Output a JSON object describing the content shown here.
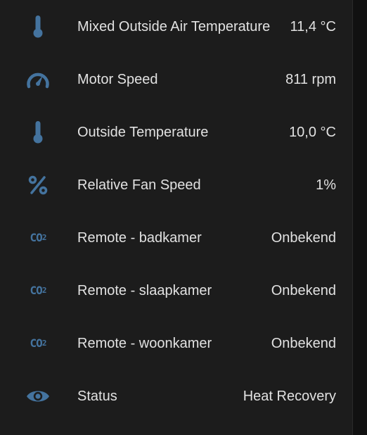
{
  "colors": {
    "background": "#1c1c1c",
    "text": "#e1e1e1",
    "icon": "#44739e"
  },
  "entities": [
    {
      "icon": "thermometer-icon",
      "label": "Mixed Outside Air Temperature",
      "value": "11,4 °C"
    },
    {
      "icon": "gauge-icon",
      "label": "Motor Speed",
      "value": "811 rpm"
    },
    {
      "icon": "thermometer-icon",
      "label": "Outside Temperature",
      "value": "10,0 °C"
    },
    {
      "icon": "percent-icon",
      "label": "Relative Fan Speed",
      "value": "1%"
    },
    {
      "icon": "co2-icon",
      "label": "Remote - badkamer",
      "value": "Onbekend"
    },
    {
      "icon": "co2-icon",
      "label": "Remote - slaapkamer",
      "value": "Onbekend"
    },
    {
      "icon": "co2-icon",
      "label": "Remote - woonkamer",
      "value": "Onbekend"
    },
    {
      "icon": "eye-icon",
      "label": "Status",
      "value": "Heat Recovery"
    }
  ],
  "co2_icon_text": "CO",
  "co2_icon_sub": "2"
}
